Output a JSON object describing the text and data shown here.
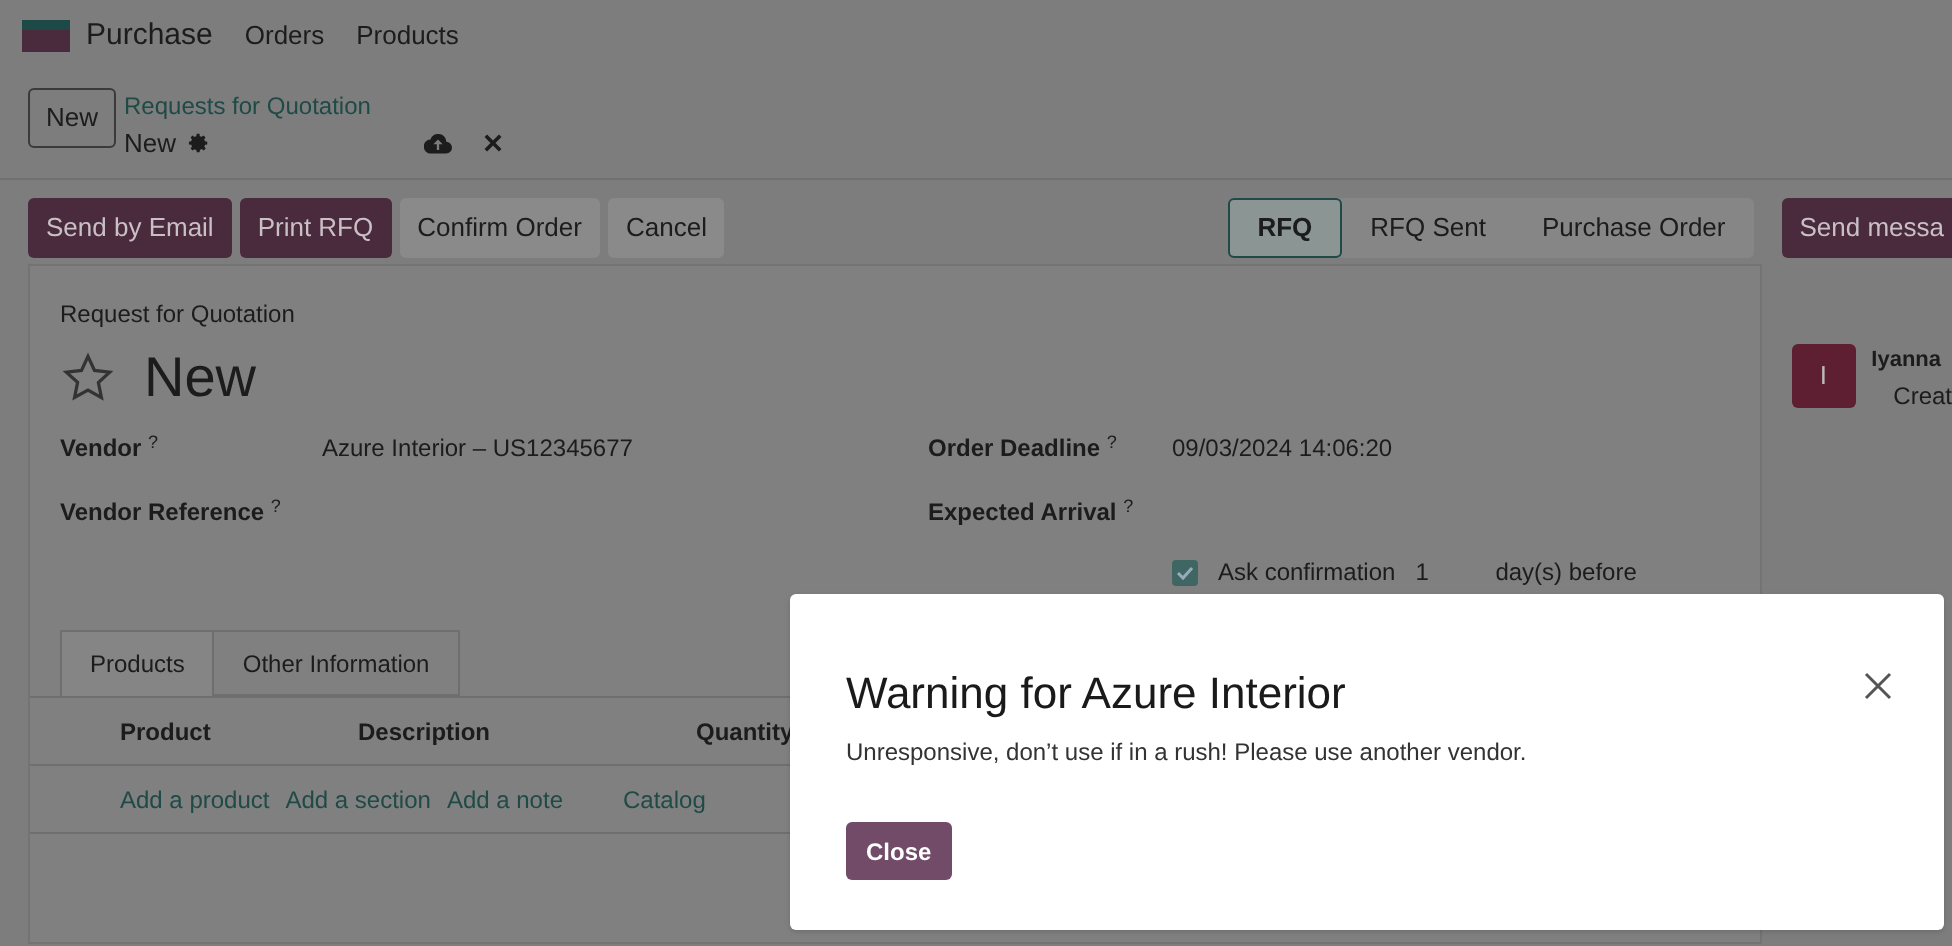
{
  "navbar": {
    "app_name": "Purchase",
    "menu": [
      "Orders",
      "Products"
    ]
  },
  "control_panel": {
    "new_button": "New",
    "breadcrumb": "Requests for Quotation",
    "record_name": "New"
  },
  "actions": [
    {
      "label": "Send by Email",
      "kind": "primary"
    },
    {
      "label": "Print RFQ",
      "kind": "primary"
    },
    {
      "label": "Confirm Order",
      "kind": "secondary"
    },
    {
      "label": "Cancel",
      "kind": "secondary"
    }
  ],
  "status_steps": [
    {
      "label": "RFQ",
      "selected": true
    },
    {
      "label": "RFQ Sent",
      "selected": false
    },
    {
      "label": "Purchase Order",
      "selected": false
    }
  ],
  "form": {
    "subtitle": "Request for Quotation",
    "title": "New",
    "starred": false,
    "left_fields": [
      {
        "label": "Vendor",
        "help": "?",
        "value": "Azure Interior – US12345677"
      },
      {
        "label": "Vendor Reference",
        "help": "?"
      }
    ],
    "right_fields": [
      {
        "label": "Order Deadline",
        "help": "?",
        "value": "09/03/2024 14:06:20"
      },
      {
        "label": "Expected Arrival",
        "help": "?"
      }
    ],
    "ask_confirmation": {
      "checked": true,
      "label": "Ask confirmation",
      "days": "1",
      "suffix": "day(s) before"
    },
    "tabs": [
      {
        "label": "Products",
        "selected": true
      },
      {
        "label": "Other Information",
        "selected": false
      }
    ],
    "columns": [
      "Product",
      "Description",
      "Quantity"
    ],
    "line_links": [
      "Add a product",
      "Add a section",
      "Add a note",
      "Catalog"
    ]
  },
  "chatter": {
    "send_button": "Send messa",
    "avatar_letter": "I",
    "author": "Iyanna",
    "message": "Creat"
  },
  "dialog": {
    "title": "Warning for Azure Interior",
    "message": "Unresponsive, don’t use if in a rush! Please use another vendor.",
    "close_button": "Close"
  }
}
